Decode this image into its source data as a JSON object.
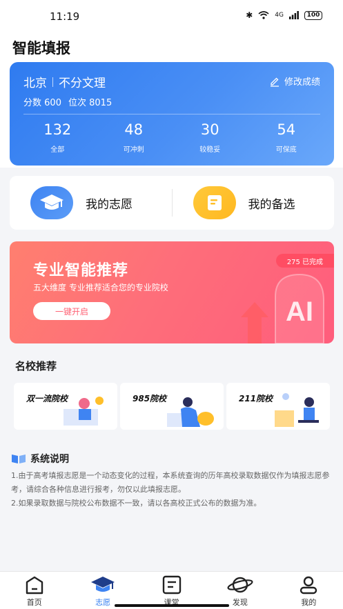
{
  "status": {
    "time": "11:19",
    "signal": "4G",
    "battery": "100"
  },
  "page": {
    "title": "智能填报"
  },
  "score_card": {
    "region": "北京",
    "subject": "不分文理",
    "edit_label": "修改成绩",
    "score_label": "分数",
    "score": "600",
    "rank_label": "位次",
    "rank": "8015",
    "stats": [
      {
        "value": "132",
        "label": "全部"
      },
      {
        "value": "48",
        "label": "可冲刺"
      },
      {
        "value": "30",
        "label": "较稳妥"
      },
      {
        "value": "54",
        "label": "可保底"
      }
    ]
  },
  "quick": {
    "my_wish": "我的志愿",
    "my_backup": "我的备选"
  },
  "banner": {
    "title": "专业智能推荐",
    "subtitle": "五大维度 专业推荐适合您的专业院校",
    "button": "一键开启",
    "badge": "275 已完成",
    "art_text": "AI"
  },
  "schools": {
    "title": "名校推荐",
    "items": [
      {
        "label": "双一流院校"
      },
      {
        "label": "985院校"
      },
      {
        "label": "211院校"
      }
    ]
  },
  "notes": {
    "title": "系统说明",
    "lines": [
      "1.由于高考填报志愿是一个动态变化的过程，本系统查询的历年高校录取数据仅作为填报志愿参考，请综合各种信息进行报考，勿仅以此填报志愿。",
      "2.如果录取数据与院校公布数据不一致，请以各高校正式公布的数据为准。"
    ]
  },
  "tabs": [
    {
      "label": "首页",
      "icon": "home-icon"
    },
    {
      "label": "志愿",
      "icon": "graduation-cap-icon"
    },
    {
      "label": "课堂",
      "icon": "classroom-icon"
    },
    {
      "label": "发现",
      "icon": "planet-icon"
    },
    {
      "label": "我的",
      "icon": "profile-icon"
    }
  ],
  "colors": {
    "primary": "#2f7bf0",
    "banner": "#ff6a78",
    "yellow": "#ffbf2a"
  }
}
